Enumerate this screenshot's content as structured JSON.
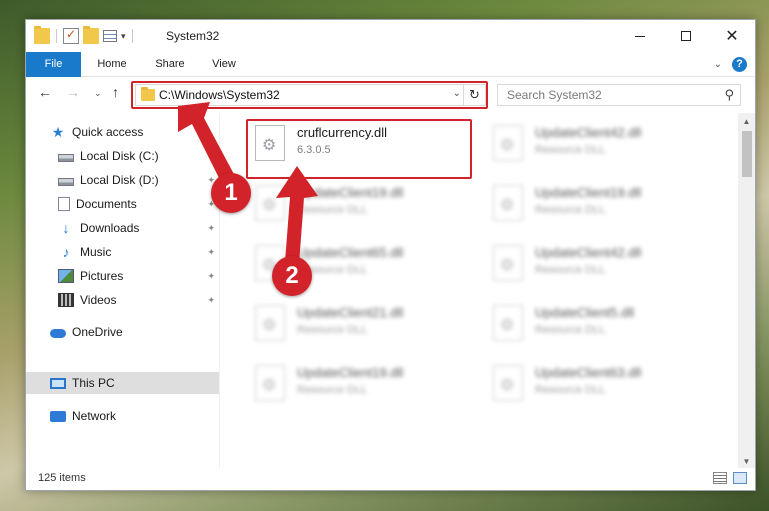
{
  "window": {
    "title": "System32",
    "controls": {
      "minimize": "minimize",
      "maximize": "maximize",
      "close": "✕"
    }
  },
  "ribbon": {
    "tabs": [
      "File",
      "Home",
      "Share",
      "View"
    ],
    "collapse_glyph": "⌄",
    "help_glyph": "?"
  },
  "nav": {
    "back": "←",
    "forward": "→",
    "recent": "⌄",
    "up": "↑"
  },
  "address": {
    "path": "C:\\Windows\\System32",
    "dropdown": "⌄",
    "refresh": "↻"
  },
  "search": {
    "placeholder": "Search System32",
    "icon": "⚲"
  },
  "sidebar": {
    "items": [
      {
        "label": "Quick access",
        "icon": "star-icon",
        "pinned": false
      },
      {
        "label": "Local Disk (C:)",
        "icon": "disk-icon",
        "pinned": true
      },
      {
        "label": "Local Disk (D:)",
        "icon": "disk-icon",
        "pinned": true
      },
      {
        "label": "Documents",
        "icon": "documents-icon",
        "pinned": true
      },
      {
        "label": "Downloads",
        "icon": "download-icon",
        "pinned": true
      },
      {
        "label": "Music",
        "icon": "music-icon",
        "pinned": true
      },
      {
        "label": "Pictures",
        "icon": "pictures-icon",
        "pinned": true
      },
      {
        "label": "Videos",
        "icon": "videos-icon",
        "pinned": true
      },
      {
        "label": "OneDrive",
        "icon": "cloud-icon",
        "pinned": false
      },
      {
        "label": "This PC",
        "icon": "computer-icon",
        "pinned": false,
        "selected": true
      },
      {
        "label": "Network",
        "icon": "network-icon",
        "pinned": false
      }
    ],
    "pin_glyph": "📌"
  },
  "files": [
    {
      "name": "cruflcurrency.dll",
      "sub": "6.3.0.5",
      "highlighted": true
    },
    {
      "name": "UpdateClient42.dll",
      "sub": "Resource DLL"
    },
    {
      "name": "UpdateClient19.dll",
      "sub": "Resource DLL"
    },
    {
      "name": "UpdateClient19.dll",
      "sub": "Resource DLL"
    },
    {
      "name": "UpdateClient65.dll",
      "sub": "Resource DLL"
    },
    {
      "name": "UpdateClient42.dll",
      "sub": "Resource DLL"
    },
    {
      "name": "UpdateClient21.dll",
      "sub": "Resource DLL"
    },
    {
      "name": "UpdateClient5.dll",
      "sub": "Resource DLL"
    },
    {
      "name": "UpdateClient19.dll",
      "sub": "Resource DLL"
    },
    {
      "name": "UpdateClient63.dll",
      "sub": "Resource DLL"
    }
  ],
  "status": {
    "item_count": "125 items"
  },
  "callouts": {
    "step1": "1",
    "step2": "2"
  },
  "colors": {
    "accent": "#1979ca",
    "annotation_red": "#d3232a",
    "selection_gray": "#dedede"
  }
}
